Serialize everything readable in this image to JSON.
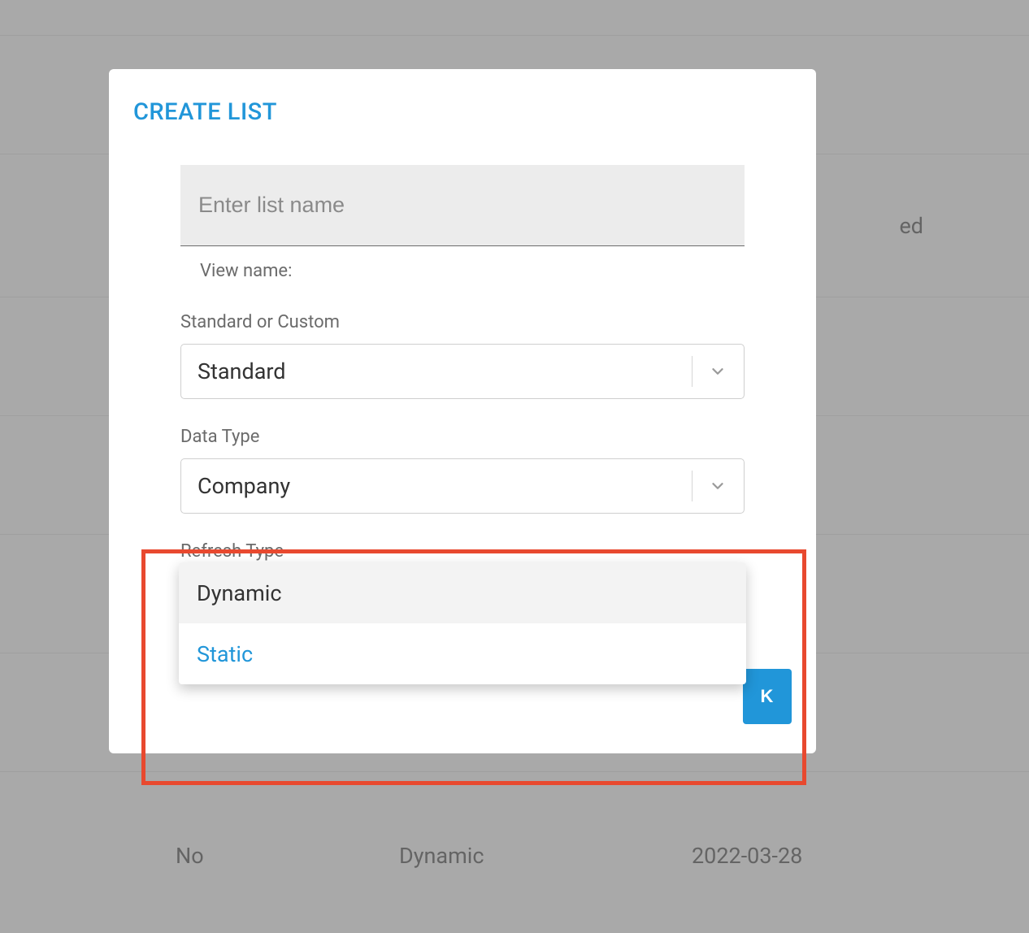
{
  "background": {
    "header_cell": "ed",
    "bottom_row": {
      "c1": "No",
      "c2": "Dynamic",
      "c3": "2022-03-28"
    }
  },
  "modal": {
    "title": "CREATE LIST",
    "name_placeholder": "Enter list name",
    "view_name_label": "View name:",
    "fields": {
      "standard_custom": {
        "label": "Standard or Custom",
        "value": "Standard"
      },
      "data_type": {
        "label": "Data Type",
        "value": "Company"
      },
      "refresh_type": {
        "label": "Refresh Type",
        "value": "Dynamic"
      }
    },
    "ok_label": "K"
  },
  "dropdown": {
    "options": [
      "Dynamic",
      "Static"
    ]
  }
}
